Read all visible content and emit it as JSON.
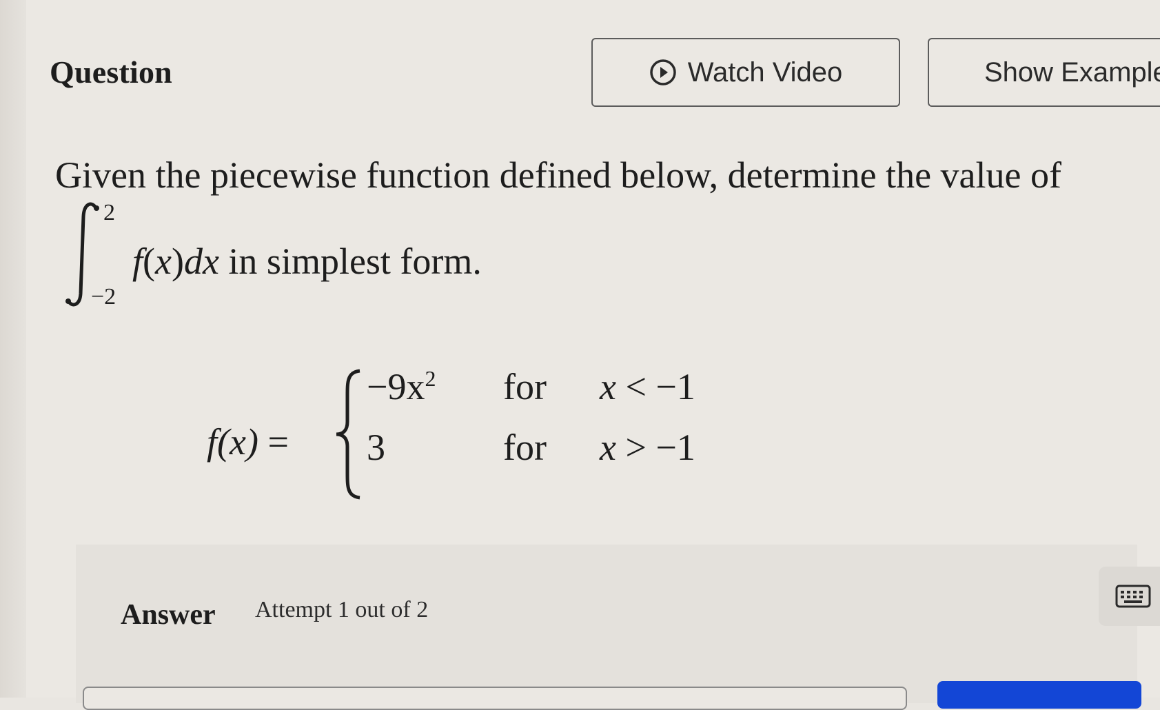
{
  "header": {
    "title": "Question",
    "watch_video_label": "Watch Video",
    "show_examples_label": "Show Example"
  },
  "question": {
    "prompt": "Given the piecewise function defined below, determine the value of",
    "integral": {
      "upper": "2",
      "lower": "−2",
      "integrand_f": "f",
      "integrand_paren_open": "(",
      "integrand_var": "x",
      "integrand_paren_close": ")",
      "integrand_d": "dx",
      "suffix": " in simplest form."
    },
    "piecewise": {
      "lhs_f": "f",
      "lhs_arg": "(x)",
      "equals": "=",
      "cases": [
        {
          "expr": "−9x",
          "exponent": "2",
          "word": "for",
          "cond_var": "x",
          "cond_rel": "< −1"
        },
        {
          "expr": "3",
          "exponent": "",
          "word": "for",
          "cond_var": "x",
          "cond_rel": "> −1"
        }
      ]
    }
  },
  "answer": {
    "label": "Answer",
    "attempt_text": "Attempt 1 out of 2"
  },
  "icons": {
    "play": "play-circle-icon",
    "keyboard": "keyboard-icon"
  },
  "colors": {
    "background": "#ebe8e3",
    "submit_blue": "#1346d6"
  }
}
